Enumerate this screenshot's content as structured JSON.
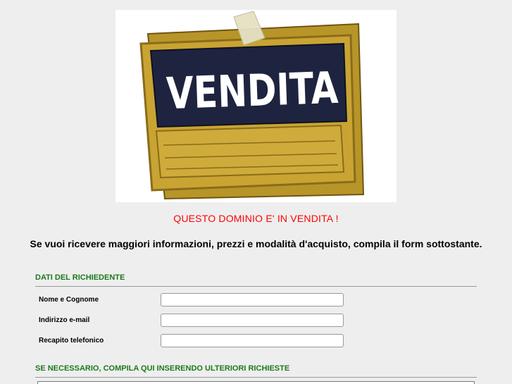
{
  "hero": {
    "sign_text": "VENDITA",
    "colors": {
      "board": "#c9a433",
      "board_dark": "#8a6c1a",
      "banner": "#1e2440",
      "tape": "#e4e1c4"
    }
  },
  "headline": "QUESTO DOMINIO E' IN VENDITA !",
  "intro": "Se vuoi ricevere maggiori informazioni, prezzi e modalità d'acquisto, compila il form sottostante.",
  "form": {
    "section_requester": "DATI DEL RICHIEDENTE",
    "fields": [
      {
        "label": "Nome e Cognome",
        "value": ""
      },
      {
        "label": "Indirizzo e-mail",
        "value": ""
      },
      {
        "label": "Recapito telefonico",
        "value": ""
      }
    ],
    "section_notes": "SE NECESSARIO, COMPILA QUI INSERENDO ULTERIORI RICHIESTE",
    "notes_value": ""
  },
  "colors": {
    "background": "#eeeeee",
    "headline": "#ff0000",
    "section_title": "#1a7a1a"
  }
}
